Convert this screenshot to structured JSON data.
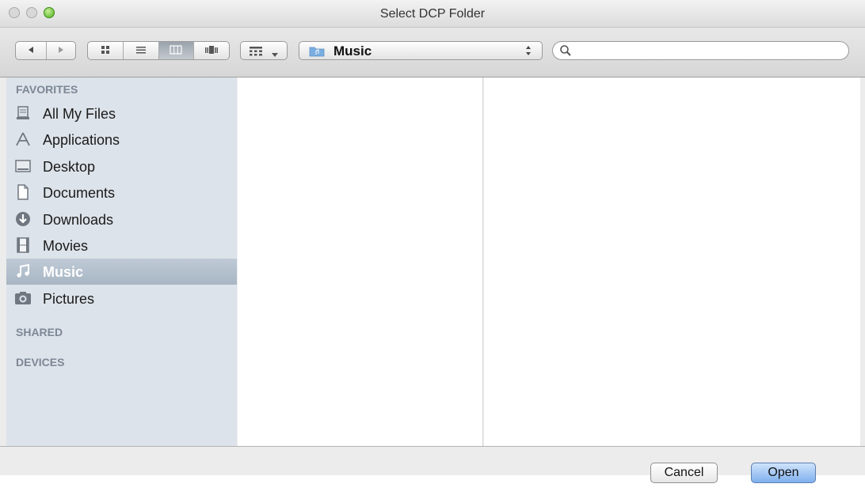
{
  "window": {
    "title": "Select DCP Folder"
  },
  "toolbar": {
    "back_icon": "back-arrow-icon",
    "forward_icon": "forward-arrow-icon",
    "view_modes": [
      "icon-view-icon",
      "list-view-icon",
      "column-view-icon",
      "cover-flow-icon"
    ],
    "active_view": "column",
    "arrange_icon": "arrange-menu-icon",
    "location": {
      "label": "Music",
      "icon": "music-folder-icon"
    },
    "search": {
      "placeholder": "",
      "value": ""
    }
  },
  "sidebar": {
    "sections": {
      "favorites": "FAVORITES",
      "shared": "SHARED",
      "devices": "DEVICES"
    },
    "items": [
      {
        "label": "All My Files",
        "icon": "all-my-files-icon",
        "selected": false
      },
      {
        "label": "Applications",
        "icon": "applications-icon",
        "selected": false
      },
      {
        "label": "Desktop",
        "icon": "desktop-icon",
        "selected": false
      },
      {
        "label": "Documents",
        "icon": "documents-icon",
        "selected": false
      },
      {
        "label": "Downloads",
        "icon": "downloads-icon",
        "selected": false
      },
      {
        "label": "Movies",
        "icon": "movies-icon",
        "selected": false
      },
      {
        "label": "Music",
        "icon": "music-icon",
        "selected": true
      },
      {
        "label": "Pictures",
        "icon": "pictures-icon",
        "selected": false
      }
    ]
  },
  "buttons": {
    "cancel": "Cancel",
    "open": "Open"
  },
  "colors": {
    "sidebar_bg": "#dde3ea",
    "selection": "#a8b6c4",
    "section_header": "#7c8796",
    "open_button": "#7fb0ee"
  }
}
